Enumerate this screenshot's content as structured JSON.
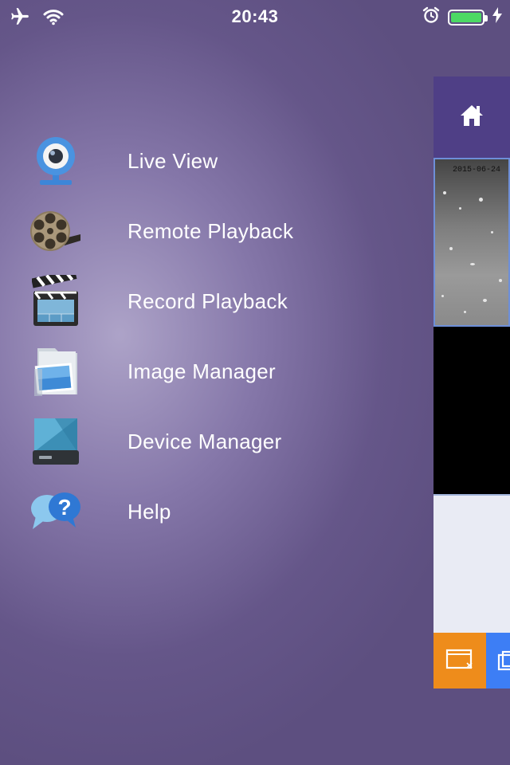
{
  "status_bar": {
    "time": "20:43",
    "icons": [
      "airplane-icon",
      "wifi-icon",
      "alarm-icon",
      "battery-icon",
      "charging-bolt-icon"
    ],
    "battery_level": 1.0,
    "battery_color": "#4cd964"
  },
  "menu": {
    "items": [
      {
        "label": "Live View",
        "icon": "webcam-icon"
      },
      {
        "label": "Remote Playback",
        "icon": "film-reel-icon"
      },
      {
        "label": "Record Playback",
        "icon": "clapperboard-icon"
      },
      {
        "label": "Image Manager",
        "icon": "photo-folder-icon"
      },
      {
        "label": "Device Manager",
        "icon": "hard-drive-icon"
      },
      {
        "label": "Help",
        "icon": "help-bubble-icon"
      }
    ]
  },
  "peek_panel": {
    "header_icon": "home-icon",
    "video1_timestamp": "2015-06-24",
    "button1_icon": "close-window-icon",
    "button2_icon": "copy-window-icon",
    "colors": {
      "header": "#4f3f86",
      "orange": "#ee8c1b",
      "blue": "#3d7ef5"
    }
  }
}
